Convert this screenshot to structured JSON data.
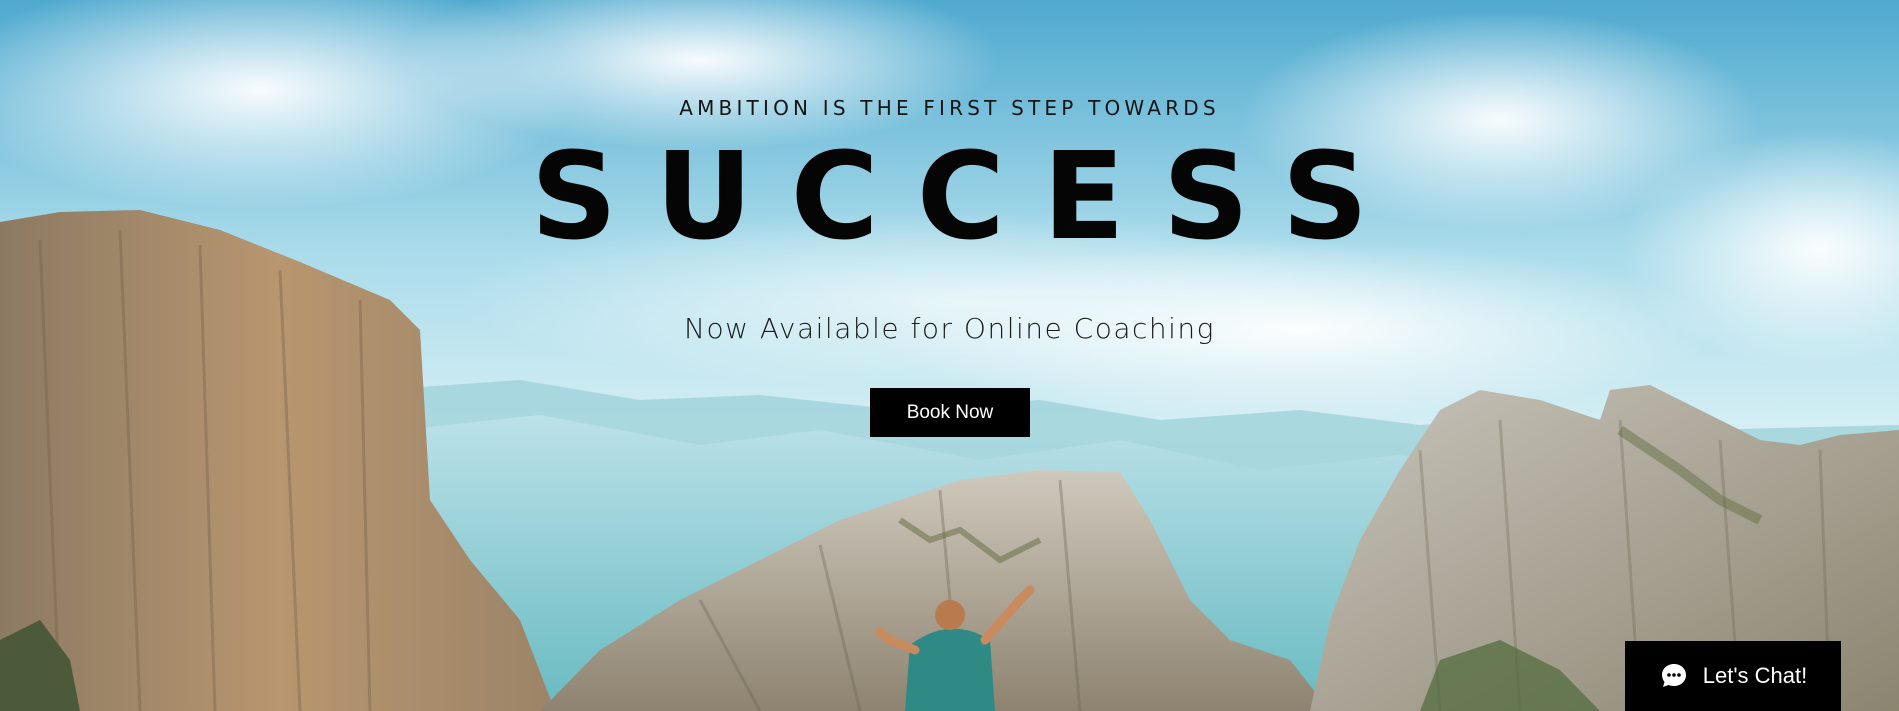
{
  "hero": {
    "tagline": "AMBITION IS THE FIRST STEP TOWARDS",
    "headline": "SUCCESS",
    "subline": "Now Available for Online Coaching",
    "cta_label": "Book Now"
  },
  "chat": {
    "label": "Let's Chat!",
    "icon": "chat-bubble-icon"
  },
  "colors": {
    "sky_top": "#5fb5d6",
    "sky_light": "#d7eef5",
    "text_dark": "#050505",
    "button_bg": "#000000",
    "button_text": "#ffffff"
  }
}
